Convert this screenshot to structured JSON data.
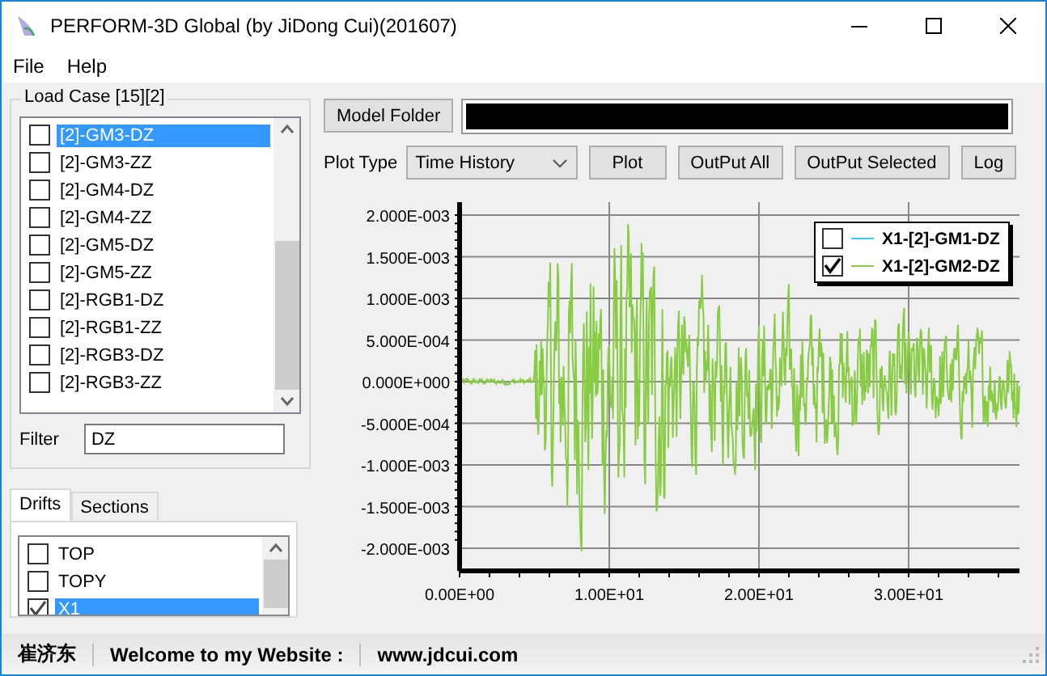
{
  "window": {
    "title": "PERFORM-3D Global (by JiDong Cui)(201607)"
  },
  "menu": [
    "File",
    "Help"
  ],
  "load_case": {
    "title": "Load Case [15][2]",
    "items": [
      {
        "label": "[2]-GM3-DZ",
        "checked": false,
        "selected": true
      },
      {
        "label": "[2]-GM3-ZZ",
        "checked": false,
        "selected": false
      },
      {
        "label": "[2]-GM4-DZ",
        "checked": false,
        "selected": false
      },
      {
        "label": "[2]-GM4-ZZ",
        "checked": false,
        "selected": false
      },
      {
        "label": "[2]-GM5-DZ",
        "checked": false,
        "selected": false
      },
      {
        "label": "[2]-GM5-ZZ",
        "checked": false,
        "selected": false
      },
      {
        "label": "[2]-RGB1-DZ",
        "checked": false,
        "selected": false
      },
      {
        "label": "[2]-RGB1-ZZ",
        "checked": false,
        "selected": false
      },
      {
        "label": "[2]-RGB3-DZ",
        "checked": false,
        "selected": false
      },
      {
        "label": "[2]-RGB3-ZZ",
        "checked": false,
        "selected": false
      }
    ]
  },
  "filter": {
    "label": "Filter",
    "value": "DZ"
  },
  "tabs": [
    {
      "label": "Drifts",
      "selected": true
    },
    {
      "label": "Sections",
      "selected": false
    }
  ],
  "drifts": [
    {
      "label": "TOP",
      "checked": false,
      "selected": false
    },
    {
      "label": "TOPY",
      "checked": false,
      "selected": false
    },
    {
      "label": "X1",
      "checked": true,
      "selected": true
    }
  ],
  "toolbar": {
    "model_folder": "Model Folder",
    "plot_type_label": "Plot Type",
    "plot_type": "Time History",
    "buttons": [
      "Plot",
      "OutPut All",
      "OutPut Selected",
      "Log"
    ]
  },
  "chart": {
    "y_tick_labels": [
      "2.000E-003",
      "1.500E-003",
      "1.000E-003",
      "5.000E-004",
      "0.000E+000",
      "-5.000E-004",
      "-1.000E-003",
      "-1.500E-003",
      "-2.000E-003"
    ],
    "x_tick_labels": [
      "0.00E+00",
      "1.00E+01",
      "2.00E+01",
      "3.00E+01"
    ],
    "legend": [
      {
        "label": "X1-[2]-GM1-DZ",
        "checked": false,
        "color": "#33ccff"
      },
      {
        "label": "X1-[2]-GM2-DZ",
        "checked": true,
        "color": "#88cc44"
      }
    ]
  },
  "status_bar": [
    "崔济东",
    "Welcome to my Website :",
    "www.jdcui.com"
  ]
}
